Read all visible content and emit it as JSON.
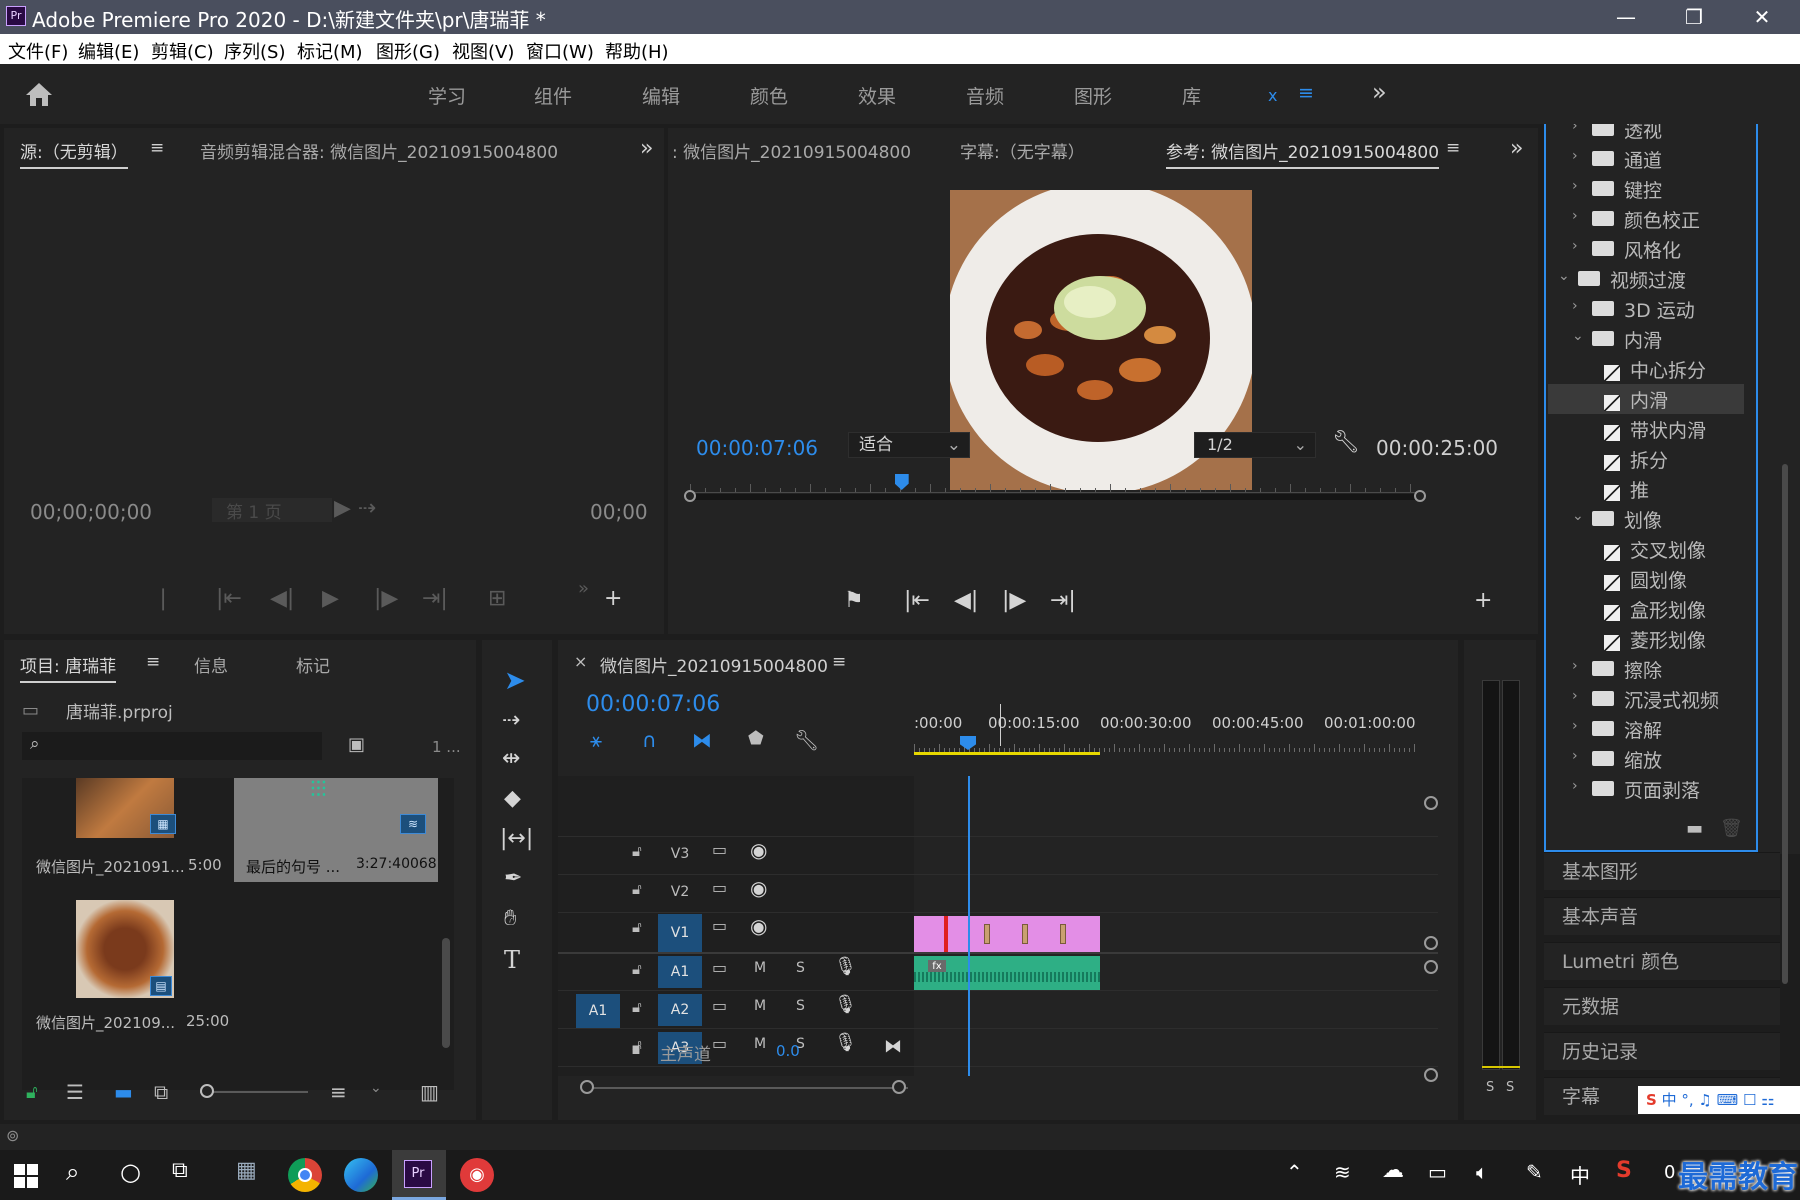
{
  "window": {
    "app_abbr": "Pr",
    "title": "Adobe Premiere Pro 2020 - D:\\新建文件夹\\pr\\唐瑞菲 *",
    "minimize": "—",
    "maximize": "❐",
    "close": "✕"
  },
  "menu": [
    "文件(F)",
    "编辑(E)",
    "剪辑(C)",
    "序列(S)",
    "标记(M)",
    "图形(G)",
    "视图(V)",
    "窗口(W)",
    "帮助(H)"
  ],
  "workspaces": {
    "tabs": [
      "学习",
      "组件",
      "编辑",
      "颜色",
      "效果",
      "音频",
      "图形",
      "库"
    ],
    "close_x": "x",
    "menu_icon": "≡",
    "more": "»"
  },
  "source_panel": {
    "tab_source": "源:（无剪辑）",
    "tab_mixer": "音频剪辑混合器: 微信图片_20210915004800",
    "timecode_left": "00;00;00;00",
    "page": "第 1 页",
    "timecode_right": "00;00"
  },
  "program_panel": {
    "tab_program": ": 微信图片_20210915004800",
    "tab_captions": "字幕:（无字幕）",
    "tab_reference": "参考: 微信图片_20210915004800",
    "timecode": "00:00:07:06",
    "fit": "适合",
    "resolution": "1/2",
    "duration": "00:00:25:00",
    "playhead_fraction": 0.29
  },
  "project_panel": {
    "tab_project": "项目: 唐瑞菲",
    "tab_info": "信息",
    "tab_markers": "标记",
    "file": "唐瑞菲.prproj",
    "count": "1 ...",
    "items": [
      {
        "name": "微信图片_2021091...",
        "duration": "5:00"
      },
      {
        "name": "最后的句号 ...",
        "duration": "3:27:40068"
      },
      {
        "name": "微信图片_202109...",
        "duration": "25:00"
      }
    ]
  },
  "timeline": {
    "sequence_name": "微信图片_20210915004800",
    "timecode": "00:00:07:06",
    "ruler": [
      ":00:00",
      "00:00:15:00",
      "00:00:30:00",
      "00:00:45:00",
      "00:01:00:00"
    ],
    "video_tracks": [
      "V3",
      "V2",
      "V1"
    ],
    "audio_tracks": [
      "A1",
      "A2",
      "A3"
    ],
    "source_patch": "A1",
    "mute": "M",
    "solo": "S",
    "master_label": "主声道",
    "master_value": "0.0",
    "clip_fx": "fx"
  },
  "effects_tree": [
    {
      "label": "透视",
      "kind": "folder",
      "level": 1
    },
    {
      "label": "通道",
      "kind": "folder",
      "level": 1
    },
    {
      "label": "键控",
      "kind": "folder",
      "level": 1
    },
    {
      "label": "颜色校正",
      "kind": "folder",
      "level": 1
    },
    {
      "label": "风格化",
      "kind": "folder",
      "level": 1
    },
    {
      "label": "视频过渡",
      "kind": "folder-open",
      "level": 0
    },
    {
      "label": "3D 运动",
      "kind": "folder",
      "level": 1
    },
    {
      "label": "内滑",
      "kind": "folder-open",
      "level": 1
    },
    {
      "label": "中心拆分",
      "kind": "item",
      "level": 2
    },
    {
      "label": "内滑",
      "kind": "item",
      "level": 2,
      "selected": true
    },
    {
      "label": "带状内滑",
      "kind": "item",
      "level": 2
    },
    {
      "label": "拆分",
      "kind": "item",
      "level": 2
    },
    {
      "label": "推",
      "kind": "item",
      "level": 2
    },
    {
      "label": "划像",
      "kind": "folder-open",
      "level": 1
    },
    {
      "label": "交叉划像",
      "kind": "item",
      "level": 2
    },
    {
      "label": "圆划像",
      "kind": "item",
      "level": 2
    },
    {
      "label": "盒形划像",
      "kind": "item",
      "level": 2
    },
    {
      "label": "菱形划像",
      "kind": "item",
      "level": 2
    },
    {
      "label": "擦除",
      "kind": "folder",
      "level": 1
    },
    {
      "label": "沉浸式视频",
      "kind": "folder",
      "level": 1
    },
    {
      "label": "溶解",
      "kind": "folder",
      "level": 1
    },
    {
      "label": "缩放",
      "kind": "folder",
      "level": 1
    },
    {
      "label": "页面剥落",
      "kind": "folder",
      "level": 1
    }
  ],
  "side_panels": [
    "基本图形",
    "基本声音",
    "Lumetri 颜色",
    "元数据",
    "历史记录",
    "字幕"
  ],
  "meter": {
    "solo_left": "S",
    "solo_right": "S"
  },
  "ime": "中",
  "tray": {
    "lang": "中",
    "clock_partial": "0"
  },
  "watermark": "最需教育",
  "colors": {
    "accent_blue": "#2d8ceb",
    "video_clip": "#e38ee6",
    "audio_clip": "#2eaf85",
    "playhead": "#2d8ceb"
  }
}
